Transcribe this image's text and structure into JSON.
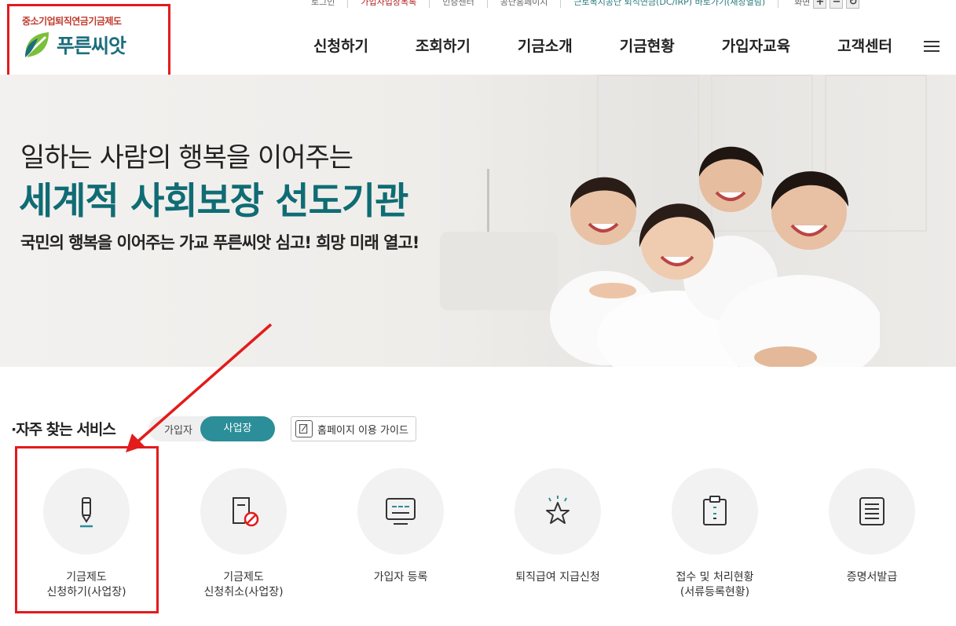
{
  "util": {
    "items": [
      "로그인",
      "가입사업장목록",
      "인증센터",
      "공단홈페이지",
      "근로복지공단 퇴직연금(DC/IRP) 바로가기(새창열림)"
    ],
    "zoom_label": "화면",
    "zoom_in": "+",
    "zoom_out": "−",
    "zoom_reset": "↻"
  },
  "logo": {
    "subtitle": "중소기업퇴직연금기금제도",
    "name": "푸른씨앗"
  },
  "gnb": [
    "신청하기",
    "조회하기",
    "기금소개",
    "기금현황",
    "가입자교육",
    "고객센터"
  ],
  "hero": {
    "line1": "일하는 사람의 행복을 이어주는",
    "line2": "세계적 사회보장 선도기관",
    "line3": "국민의 행복을 이어주는 가교 푸른씨앗 심고! 희망 미래 열고!"
  },
  "services": {
    "title": "·자주 찾는 서비스",
    "toggle": [
      "가입자",
      "사업장"
    ],
    "guide_label": "홈페이지 이용 가이드",
    "items": [
      {
        "label": "기금제도\n신청하기(사업장)",
        "icon": "pencil-icon"
      },
      {
        "label": "기금제도\n신청취소(사업장)",
        "icon": "document-cancel-icon"
      },
      {
        "label": "가입자 등록",
        "icon": "monitor-icon"
      },
      {
        "label": "퇴직급여 지급신청",
        "icon": "star-icon"
      },
      {
        "label": "접수 및 처리현황\n(서류등록현황)",
        "icon": "clipboard-icon"
      },
      {
        "label": "증명서발급",
        "icon": "certificate-icon"
      }
    ]
  },
  "colors": {
    "brand": "#0f6c74",
    "accent": "#2b8e99",
    "highlight": "#e31b1b"
  }
}
